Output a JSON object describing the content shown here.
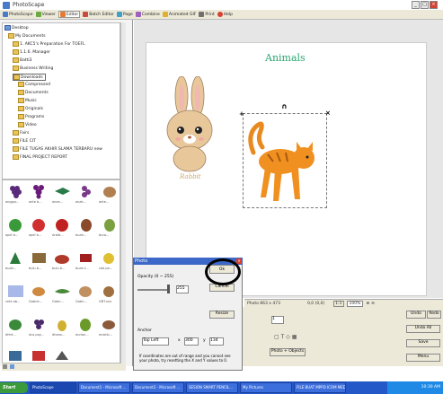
{
  "window": {
    "title": "PhotoScape"
  },
  "toolbar": {
    "items": [
      {
        "label": "PhotoScape",
        "icon": "photoscape-icon"
      },
      {
        "label": "Viewer",
        "icon": "viewer-icon"
      },
      {
        "label": "Editor",
        "icon": "editor-icon"
      },
      {
        "label": "Batch Editor",
        "icon": "batch-editor-icon"
      },
      {
        "label": "Page",
        "icon": "page-icon"
      },
      {
        "label": "Combine",
        "icon": "combine-icon"
      },
      {
        "label": "Animated GIF",
        "icon": "animated-gif-icon"
      },
      {
        "label": "Print",
        "icon": "print-icon"
      },
      {
        "label": "Help",
        "icon": "help-icon"
      }
    ]
  },
  "tree": [
    {
      "label": "Desktop",
      "level": 0
    },
    {
      "label": "My Documents",
      "level": 1
    },
    {
      "label": "1. AKC5's Preparation For TOEFL",
      "level": 2
    },
    {
      "label": "1.1.6. Manager",
      "level": 2
    },
    {
      "label": "Batti3",
      "level": 2
    },
    {
      "label": "Business Writing",
      "level": 2
    },
    {
      "label": "Downloads",
      "level": 2
    },
    {
      "label": "Compressed",
      "level": 3
    },
    {
      "label": "Documents",
      "level": 3
    },
    {
      "label": "Music",
      "level": 3
    },
    {
      "label": "Originals",
      "level": 3
    },
    {
      "label": "Programs",
      "level": 3
    },
    {
      "label": "Video",
      "level": 3
    },
    {
      "label": "Fairs",
      "level": 2
    },
    {
      "label": "FILE CIT",
      "level": 2
    },
    {
      "label": "FILE TUGAS AKHIR SLAMA TERBARU new",
      "level": 2
    },
    {
      "label": "FINAL PROJECT REPORT",
      "level": 2
    }
  ],
  "thumbnails": {
    "rows": [
      {
        "captions": [
          "anggur...",
          "ante b...",
          "anea...",
          "anak...",
          "ante..."
        ]
      },
      {
        "captions": [
          "apel b...",
          "apel b...",
          "Arbib...",
          "buah...",
          "bura..."
        ]
      },
      {
        "captions": [
          "buah...",
          "bulu b...",
          "bulu b...",
          "buah t...",
          "ceb pe..."
        ]
      },
      {
        "captions": [
          "cete ab...",
          "Gabrie...",
          "Gabri...",
          "Gabri...",
          "GBT.xxx"
        ]
      },
      {
        "captions": [
          "dfert...",
          "dus pay...",
          "dhean...",
          "durian...",
          "eciohb..."
        ]
      }
    ]
  },
  "canvas": {
    "title": "Animals",
    "rabbit_label": "Rabbit"
  },
  "statusbar": {
    "photo_size": "Photo 863 x 473",
    "coords": "0,0 (0,0)",
    "zoom": "100%"
  },
  "dialog": {
    "title": "Photo",
    "opacity_label": "Opacity (0 ~ 255)",
    "opacity_value": "255",
    "ok_label": "Ok",
    "cancel_label": "Cancel",
    "resize_label": "Resize",
    "anchor_label": "Anchor",
    "anchor_value": "Top Left",
    "x_value": "300",
    "y_value": "134",
    "note": "If coordinates are out of range and you cannot see your photo, try resetting the X and Y values to 0."
  },
  "bottom_panel": {
    "photo_objects_label": "Photo + Objects",
    "undo_label": "Undo",
    "redo_label": "Redo",
    "undo_all_label": "Undo All",
    "save_label": "Save",
    "menu_label": "Menu",
    "text_field_value": "1"
  },
  "taskbar": {
    "start_label": "Start",
    "tasks": [
      "PhotoScape",
      "Document1 - Microsoft ...",
      "Document2 - Microsoft ...",
      "SESION SMART PENCIL...",
      "My Pictures",
      "FILE BUAT MPPD ICOM MEDIA..."
    ],
    "clock": "10:30 AM"
  },
  "colors": {
    "accent": "#3c68c8",
    "title_green": "#2aa870"
  }
}
